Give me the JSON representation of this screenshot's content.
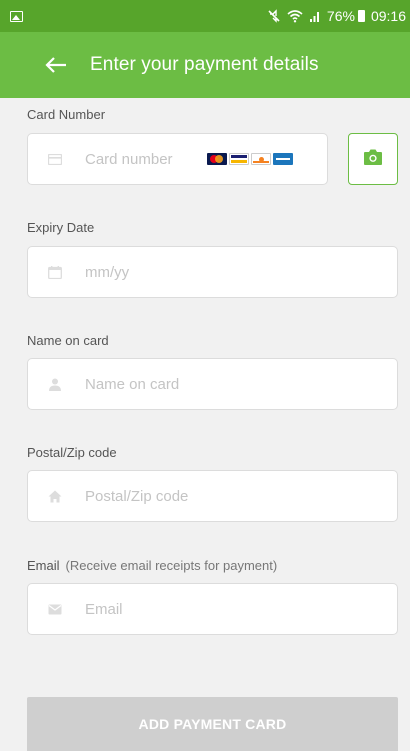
{
  "status_bar": {
    "battery": "76%",
    "time": "09:16",
    "icons": [
      "gallery-icon",
      "mute-icon",
      "wifi-icon",
      "signal-icon",
      "battery-icon"
    ]
  },
  "app_bar": {
    "title": "Enter your payment details",
    "back_icon": "arrow-left-icon"
  },
  "form": {
    "card_number": {
      "label": "Card Number",
      "placeholder": "Card number",
      "value": "",
      "icon": "credit-card-icon",
      "card_brands": [
        "mastercard",
        "visa",
        "discover",
        "amex"
      ]
    },
    "expiry": {
      "label": "Expiry Date",
      "placeholder": "mm/yy",
      "value": "",
      "icon": "calendar-icon"
    },
    "name": {
      "label": "Name on card",
      "placeholder": "Name on card",
      "value": "",
      "icon": "person-icon"
    },
    "postal": {
      "label": "Postal/Zip code",
      "placeholder": "Postal/Zip code",
      "value": "",
      "icon": "home-icon"
    },
    "email": {
      "label": "Email",
      "note": "(Receive email receipts for payment)",
      "placeholder": "Email",
      "value": "",
      "icon": "envelope-icon"
    },
    "submit_label": "ADD PAYMENT CARD"
  },
  "colors": {
    "status_bar": "#57a52b",
    "app_bar": "#6cbd44",
    "accent": "#6cbd44",
    "disabled_button": "#cfcfcf",
    "background": "#f1f1f1"
  }
}
